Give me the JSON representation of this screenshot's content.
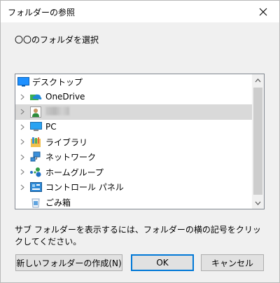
{
  "window": {
    "title": "フォルダーの参照",
    "close_icon": "close-icon"
  },
  "instruction": "〇〇のフォルダを選択",
  "tree": {
    "items": [
      {
        "label": "デスクトップ",
        "icon": "desktop-icon",
        "expandable": false
      },
      {
        "label": "OneDrive",
        "icon": "onedrive-cloud-icon",
        "expandable": true
      },
      {
        "label": "",
        "icon": "user-icon",
        "expandable": true,
        "blurred": true
      },
      {
        "label": "PC",
        "icon": "pc-monitor-icon",
        "expandable": true
      },
      {
        "label": "ライブラリ",
        "icon": "library-icon",
        "expandable": true
      },
      {
        "label": "ネットワーク",
        "icon": "network-icon",
        "expandable": true
      },
      {
        "label": "ホームグループ",
        "icon": "homegroup-icon",
        "expandable": true
      },
      {
        "label": "コントロール パネル",
        "icon": "control-panel-icon",
        "expandable": true
      },
      {
        "label": "ごみ箱",
        "icon": "recycle-bin-icon",
        "expandable": false
      }
    ]
  },
  "hint": "サブ フォルダーを表示するには、フォルダーの横の記号をクリックしてください。",
  "buttons": {
    "new_folder": "新しいフォルダーの作成(N)",
    "ok": "OK",
    "cancel": "キャンセル"
  },
  "colors": {
    "accent": "#0078d7",
    "window_bg": "#f0f0f0",
    "button_bg": "#e1e1e1"
  }
}
